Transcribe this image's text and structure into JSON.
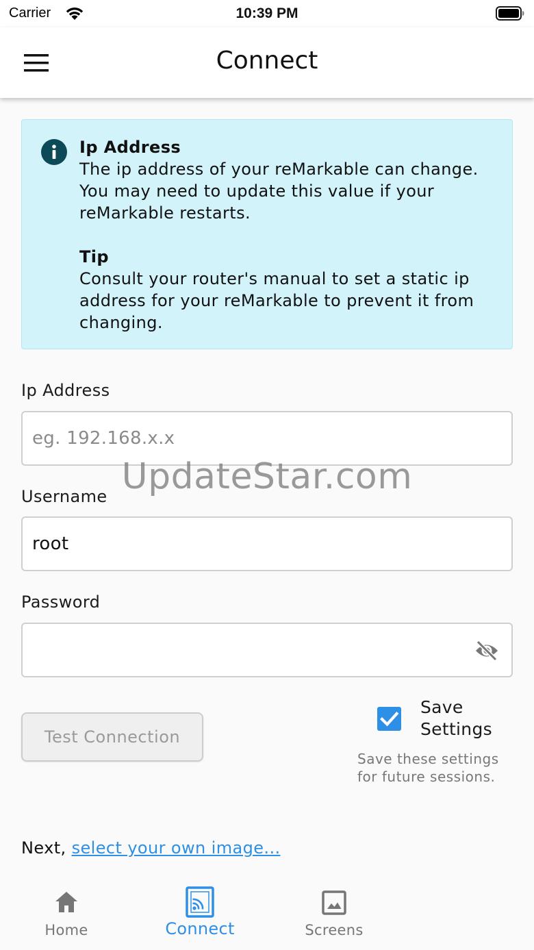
{
  "status_bar": {
    "carrier": "Carrier",
    "time": "10:39 PM"
  },
  "app_bar": {
    "title": "Connect",
    "menu_icon": "hamburger-menu-icon"
  },
  "info": {
    "icon": "info-icon",
    "heading1": "Ip Address",
    "body1": "The ip address of your reMarkable can change. You may need to update this value if your reMarkable restarts.",
    "heading2": "Tip",
    "body2": "Consult your router's manual to set a static ip address for your reMarkable to prevent it from changing."
  },
  "form": {
    "ip": {
      "label": "Ip Address",
      "placeholder": "eg. 192.168.x.x",
      "value": ""
    },
    "username": {
      "label": "Username",
      "value": "root"
    },
    "password": {
      "label": "Password",
      "value": "",
      "toggle_icon": "eye-off-icon"
    }
  },
  "actions": {
    "test_connection": "Test Connection",
    "save_settings": {
      "label": "Save Settings",
      "checked": true,
      "hint": "Save these settings for future sessions."
    }
  },
  "watermark": "UpdateStar.com",
  "next": {
    "prefix": "Next, ",
    "link": "select your own image..."
  },
  "bottom_nav": {
    "items": [
      {
        "label": "Home",
        "icon": "home-icon",
        "active": false
      },
      {
        "label": "Connect",
        "icon": "cast-connected-icon",
        "active": true
      },
      {
        "label": "Screens",
        "icon": "image-icon",
        "active": false
      }
    ]
  },
  "colors": {
    "accent": "#2d8fe6",
    "info_bg": "#d2f3fa",
    "info_icon": "#0d4a57"
  }
}
